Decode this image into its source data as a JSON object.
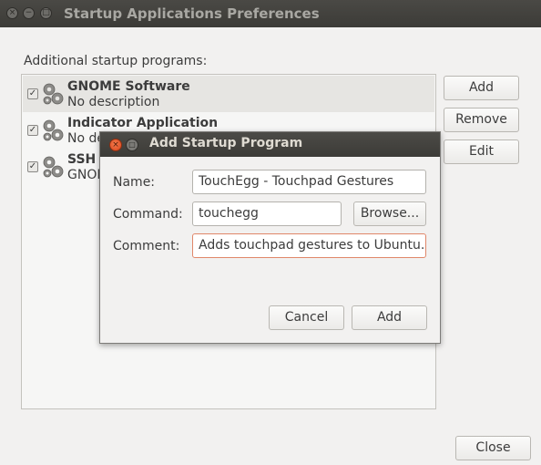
{
  "window": {
    "title": "Startup Applications Preferences",
    "close_glyph": "×",
    "minimize_glyph": "−",
    "maximize_glyph": "□"
  },
  "section_label": "Additional startup programs:",
  "programs": [
    {
      "name": "GNOME Software",
      "description": "No description",
      "checked": true,
      "icon": "gears-icon"
    },
    {
      "name": "Indicator Application",
      "description": "No de",
      "checked": true,
      "icon": "gears-icon"
    },
    {
      "name": "SSH I",
      "description": "GNOM",
      "checked": true,
      "icon": "gears-icon"
    }
  ],
  "side_buttons": {
    "add": "Add",
    "remove": "Remove",
    "edit": "Edit"
  },
  "close_button": "Close",
  "dialog": {
    "title": "Add Startup Program",
    "close_glyph": "×",
    "maximize_glyph": "□",
    "name_label": "Name:",
    "name_value": "TouchEgg - Touchpad Gestures",
    "command_label": "Command:",
    "command_value": "touchegg",
    "browse": "Browse...",
    "comment_label": "Comment:",
    "comment_value": "Adds touchpad gestures to Ubuntu.",
    "cancel": "Cancel",
    "add": "Add"
  },
  "colors": {
    "titlebar": "#3c3b37",
    "accent": "#e95420",
    "focus_border": "#e0876a"
  }
}
